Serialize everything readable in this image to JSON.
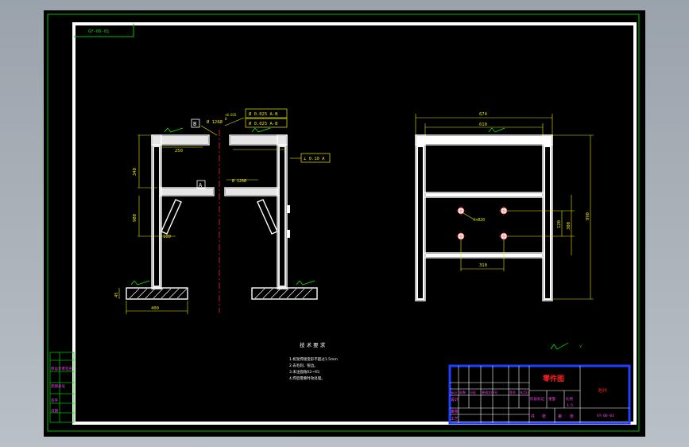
{
  "corner_code": "GY-06-01",
  "left_view": {
    "datum_b": "B",
    "datum_a": "A",
    "coaxial_dim": "Ø 126Ø",
    "coaxial_tol": "+0.035",
    "coaxial_tol_low": "0",
    "fcf_top_1": "Ø 0.025 A-B",
    "fcf_top_2": "Ø 0.025 A-B",
    "fcf_perp": "⊥ 0.10 A",
    "bore_dim": "Ø 126Ø",
    "dim_flange": "250",
    "dim_upper": "340",
    "dim_lower": "900",
    "dim_brace": "100",
    "dim_foot": "400",
    "dim_base_h": "45"
  },
  "right_view": {
    "dim_overall_w": "674",
    "dim_inner_w": "610",
    "dim_overall_h": "990",
    "dim_hole_v1": "120",
    "dim_hole_v2": "300",
    "dim_hole_spacing": "310",
    "hole_note": "4×Ø20"
  },
  "notes": {
    "title": "技 术 要 求",
    "lines": [
      "1.机架焊接变形不超过1.5mm",
      "2.去毛刺、锐边。",
      "3.未注圆角R2~R5",
      "4.焊后需要时效处理。"
    ]
  },
  "roughness": "√",
  "side_table": [
    "原设计者签名",
    "底图总号",
    "签字",
    "日期"
  ],
  "title_block": {
    "part_name": "零件图",
    "school": "池州",
    "code": "GY-06-01",
    "row_labels": [
      "标记",
      "处数",
      "分区",
      "更改文件号",
      "签名",
      "年月日"
    ],
    "designer": "设计",
    "review": "审核",
    "process": "工艺",
    "stage_labels": [
      "阶段标记",
      "重量",
      "比例"
    ],
    "scale": "1:5",
    "sheet_labels": [
      "共",
      "张",
      "第",
      "张"
    ]
  }
}
